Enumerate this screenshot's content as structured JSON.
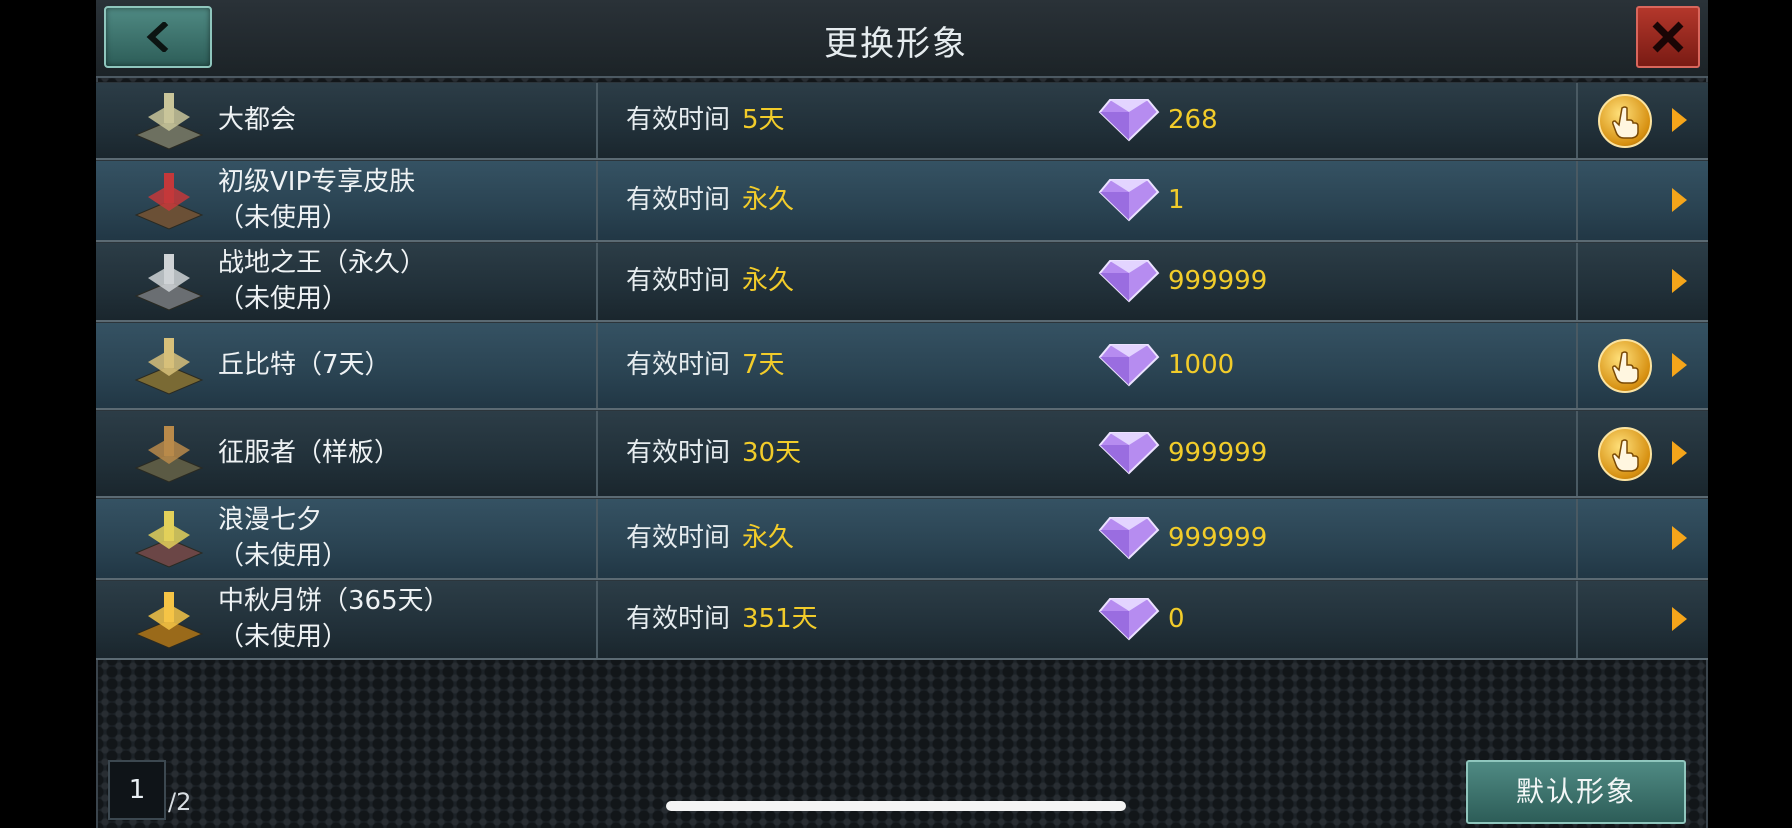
{
  "header": {
    "title": "更换形象",
    "back_icon": "chevron-left-icon",
    "close_icon": "close-x-icon"
  },
  "labels": {
    "validity_label": "有效时间"
  },
  "items": [
    {
      "name": "大都会",
      "status": "",
      "validity": "5天",
      "price": "268",
      "has_use_button": true,
      "style": "odd"
    },
    {
      "name": "初级VIP专享皮肤",
      "status": "（未使用）",
      "validity": "永久",
      "price": "1",
      "has_use_button": false,
      "style": "even"
    },
    {
      "name": "战地之王（永久）",
      "status": "（未使用）",
      "validity": "永久",
      "price": "999999",
      "has_use_button": false,
      "style": "odd"
    },
    {
      "name": "丘比特（7天）",
      "status": "",
      "validity": "7天",
      "price": "1000",
      "has_use_button": true,
      "style": "even"
    },
    {
      "name": "征服者（样板）",
      "status": "",
      "validity": "30天",
      "price": "999999",
      "has_use_button": true,
      "style": "odd"
    },
    {
      "name": "浪漫七夕",
      "status": "（未使用）",
      "validity": "永久",
      "price": "999999",
      "has_use_button": false,
      "style": "even"
    },
    {
      "name": "中秋月饼（365天）",
      "status": "（未使用）",
      "validity": "351天",
      "price": "0",
      "has_use_button": false,
      "style": "odd"
    }
  ],
  "pagination": {
    "current": "1",
    "total": "/2"
  },
  "footer": {
    "default_button_label": "默认形象"
  },
  "colors": {
    "accent_yellow": "#f2cc2a",
    "arrow_orange": "#f5a51a",
    "gem_purple": "#b68cf0"
  }
}
